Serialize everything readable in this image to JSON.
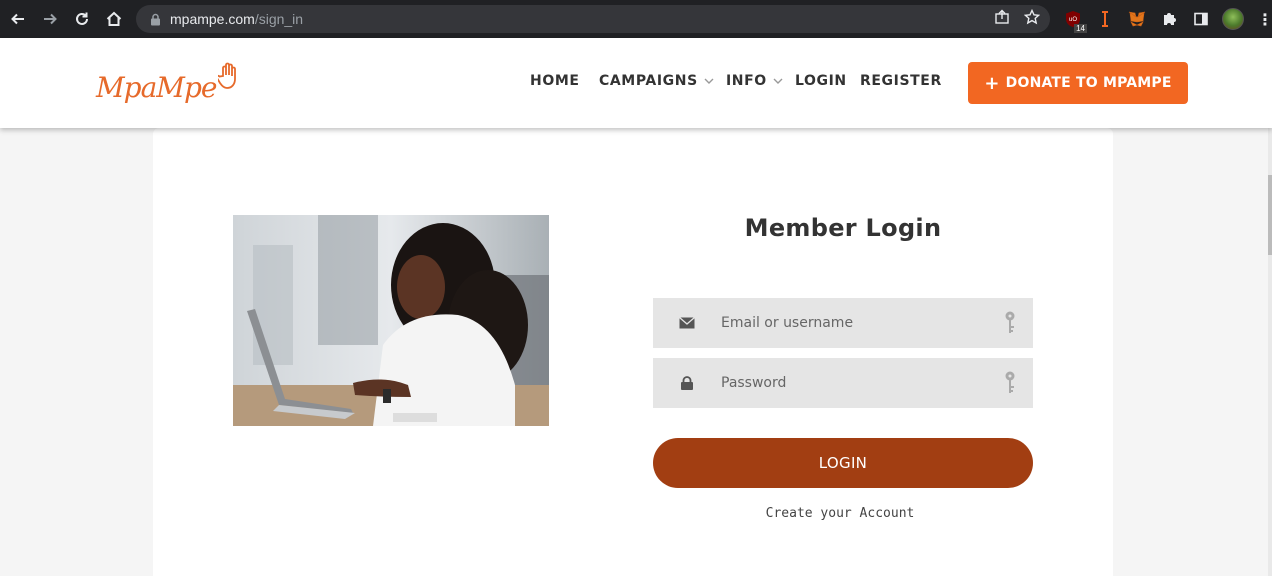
{
  "browser": {
    "url_domain": "mpampe.com",
    "url_path": "/sign_in",
    "extension_badge": "14",
    "icons": [
      "back-arrow-icon",
      "forward-arrow-icon",
      "reload-icon",
      "home-icon",
      "lock-icon",
      "share-icon",
      "star-icon",
      "ublock-icon",
      "ip-icon",
      "metamask-icon",
      "puzzle-icon",
      "sidepanel-icon",
      "kebab-menu-icon"
    ]
  },
  "header": {
    "logo_text": "MpaMpe",
    "nav": {
      "home": "HOME",
      "campaigns": "CAMPAIGNS",
      "info": "INFO",
      "login": "LOGIN",
      "register": "REGISTER"
    },
    "donate_label": "DONATE TO MPAMPE",
    "accent_color": "#f26722"
  },
  "login": {
    "title": "Member Login",
    "email_placeholder": "Email or username",
    "password_placeholder": "Password",
    "button_label": "LOGIN",
    "button_color": "#a23e12",
    "create_account": "Create your Account"
  }
}
